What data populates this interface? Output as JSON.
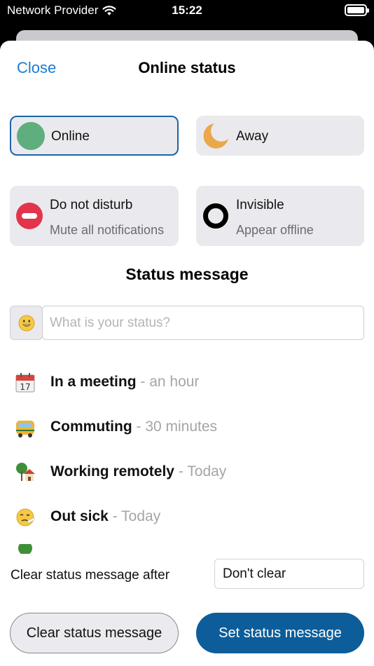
{
  "status_bar": {
    "carrier": "Network Provider",
    "time": "15:22",
    "wifi_icon": "wifi-icon",
    "battery_icon": "battery-icon"
  },
  "header": {
    "close_label": "Close",
    "title": "Online status"
  },
  "statuses": [
    {
      "id": "online",
      "label": "Online",
      "sublabel": "",
      "icon": "online-dot-icon",
      "color": "#5fae7e",
      "selected": true
    },
    {
      "id": "away",
      "label": "Away",
      "sublabel": "",
      "icon": "moon-icon",
      "color": "#eaa84a",
      "selected": false
    },
    {
      "id": "dnd",
      "label": "Do not disturb",
      "sublabel": "Mute all notifications",
      "icon": "minus-circle-icon",
      "color": "#e2344b",
      "selected": false
    },
    {
      "id": "invisible",
      "label": "Invisible",
      "sublabel": "Appear offline",
      "icon": "ring-icon",
      "color": "#000000",
      "selected": false
    }
  ],
  "status_message": {
    "section_title": "Status message",
    "emoji_button_icon": "grinning-face-icon",
    "input_placeholder": "What is your status?",
    "input_value": ""
  },
  "presets": [
    {
      "name": "In a meeting",
      "duration": " - an hour",
      "icon": "calendar-icon"
    },
    {
      "name": "Commuting",
      "duration": " - 30 minutes",
      "icon": "bus-icon"
    },
    {
      "name": "Working remotely",
      "duration": " - Today",
      "icon": "house-icon"
    },
    {
      "name": "Out sick",
      "duration": " - Today",
      "icon": "sick-face-icon"
    }
  ],
  "clear_after": {
    "label": "Clear status message after",
    "selected_value": "Don't clear"
  },
  "buttons": {
    "clear_label": "Clear status message",
    "set_label": "Set status message"
  },
  "colors": {
    "accent": "#1a7bd6",
    "primary_button": "#0c5d9a",
    "selected_border": "#1d64a6"
  }
}
